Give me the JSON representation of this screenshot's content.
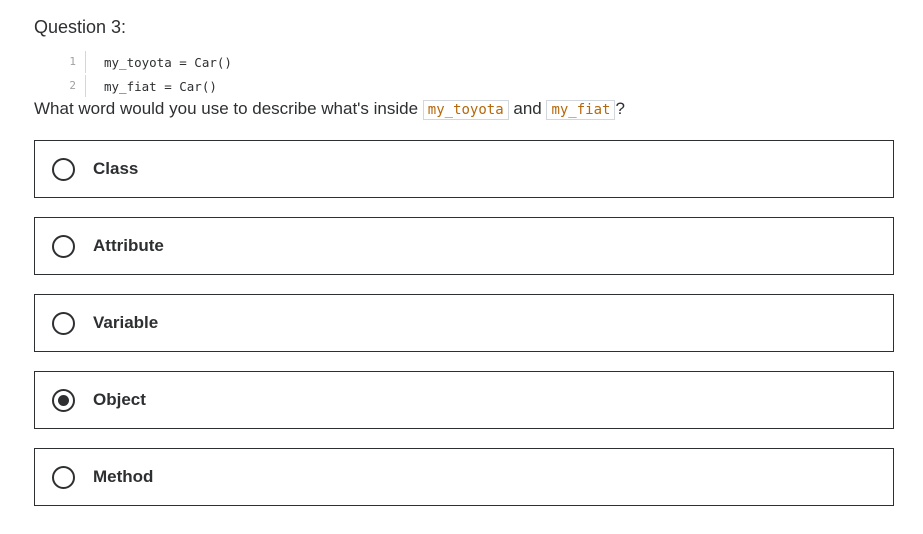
{
  "question": {
    "heading": "Question 3:",
    "code": [
      {
        "num": "1",
        "text": "my_toyota = Car()"
      },
      {
        "num": "2",
        "text": "my_fiat = Car()"
      }
    ],
    "prompt": {
      "before": "What word would you use to describe what's inside ",
      "code1": "my_toyota",
      "middle": " and ",
      "code2": "my_fiat",
      "after": "?"
    },
    "options": [
      {
        "label": "Class",
        "selected": false
      },
      {
        "label": "Attribute",
        "selected": false
      },
      {
        "label": "Variable",
        "selected": false
      },
      {
        "label": "Object",
        "selected": true
      },
      {
        "label": "Method",
        "selected": false
      }
    ]
  },
  "colors": {
    "text": "#2d2f31",
    "inline_code": "#b4690e",
    "border": "#2d2f31"
  }
}
